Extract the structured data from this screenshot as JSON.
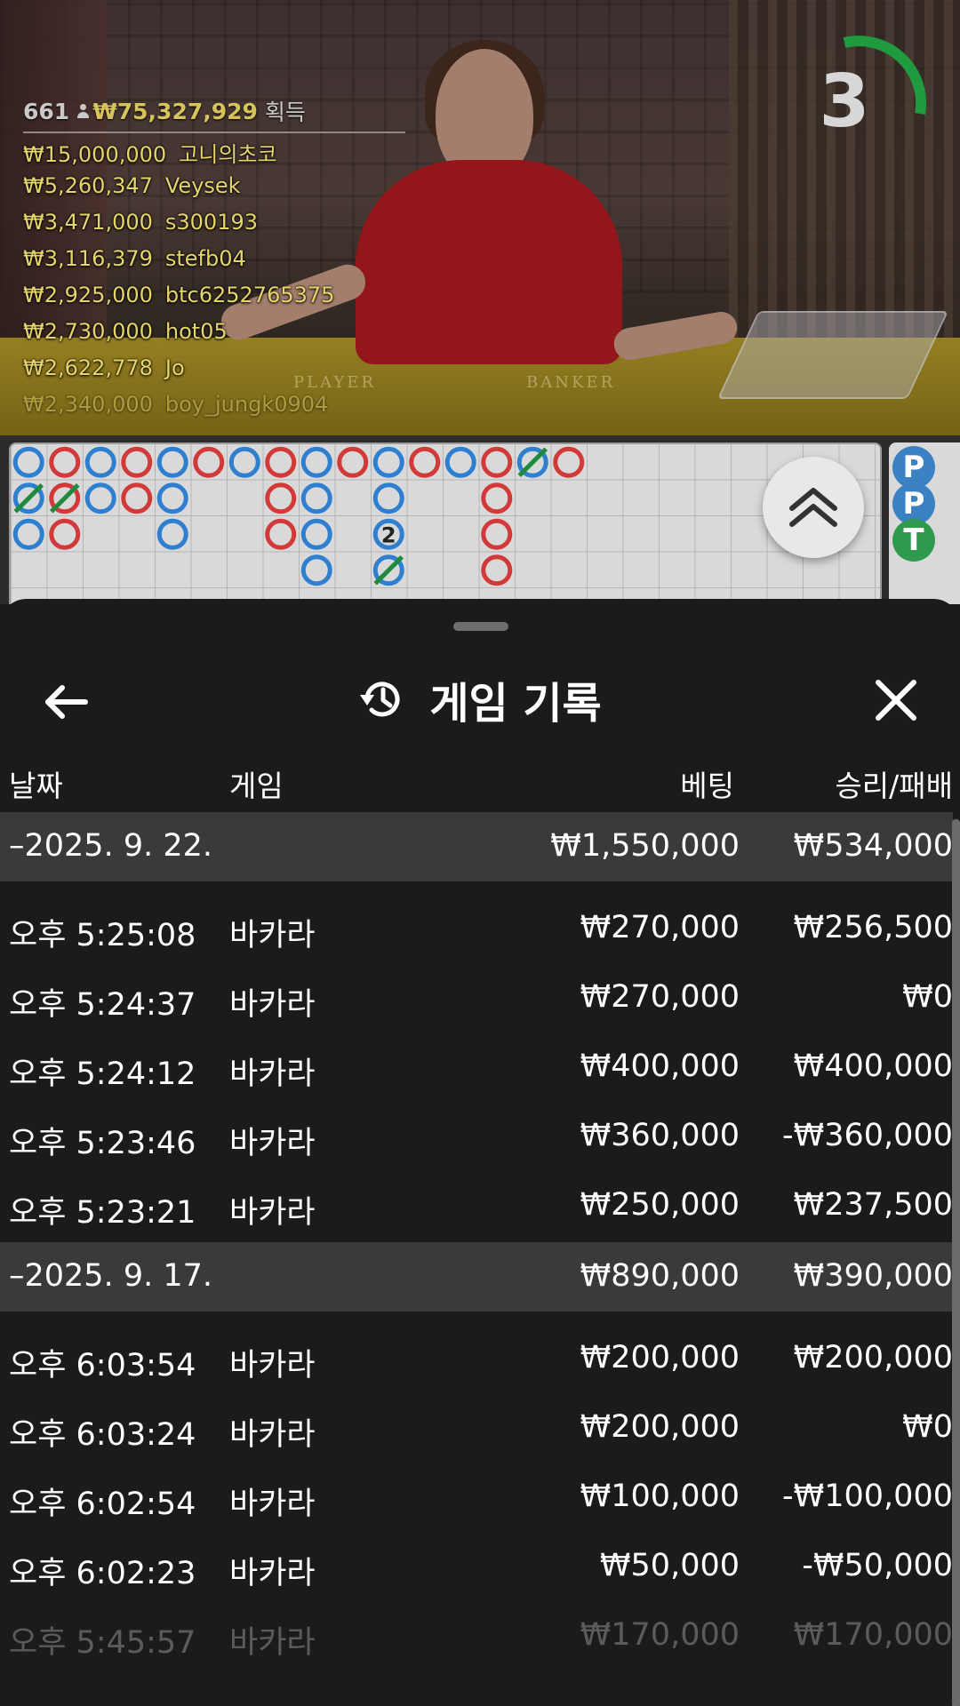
{
  "stream": {
    "player_label": "PLAYER",
    "banker_label": "BANKER",
    "timer": "3",
    "winners": {
      "count": "661",
      "total": "₩75,327,929",
      "suffix": "획득",
      "list": [
        {
          "amount": "₩15,000,000",
          "name": "고니의초코"
        },
        {
          "amount": "₩5,260,347",
          "name": "Veysek"
        },
        {
          "amount": "₩3,471,000",
          "name": "s300193"
        },
        {
          "amount": "₩3,116,379",
          "name": "stefb04"
        },
        {
          "amount": "₩2,925,000",
          "name": "btc6252765375"
        },
        {
          "amount": "₩2,730,000",
          "name": "hot05"
        },
        {
          "amount": "₩2,622,778",
          "name": "Jo"
        },
        {
          "amount": "₩2,340,000",
          "name": "boy_jungk0904"
        }
      ]
    }
  },
  "roadmap": {
    "side_chips": [
      {
        "letter": "P",
        "color": "#3b82c4"
      },
      {
        "letter": "P",
        "color": "#3b82c4"
      },
      {
        "letter": "T",
        "color": "#2e9a4e"
      }
    ],
    "marker_text": "2"
  },
  "sheet": {
    "title": "게임 기록",
    "columns": {
      "date": "날짜",
      "game": "게임",
      "bet": "베팅",
      "result": "승리/패배"
    },
    "groups": [
      {
        "date": "–2025. 9. 22.",
        "bet": "₩1,550,000",
        "result": "₩534,000",
        "rows": [
          {
            "time": "오후 5:25:08",
            "game": "바카라",
            "bet": "₩270,000",
            "result": "₩256,500"
          },
          {
            "time": "오후 5:24:37",
            "game": "바카라",
            "bet": "₩270,000",
            "result": "₩0"
          },
          {
            "time": "오후 5:24:12",
            "game": "바카라",
            "bet": "₩400,000",
            "result": "₩400,000"
          },
          {
            "time": "오후 5:23:46",
            "game": "바카라",
            "bet": "₩360,000",
            "result": "-₩360,000"
          },
          {
            "time": "오후 5:23:21",
            "game": "바카라",
            "bet": "₩250,000",
            "result": "₩237,500"
          }
        ]
      },
      {
        "date": "–2025. 9. 17.",
        "bet": "₩890,000",
        "result": "₩390,000",
        "rows": [
          {
            "time": "오후 6:03:54",
            "game": "바카라",
            "bet": "₩200,000",
            "result": "₩200,000"
          },
          {
            "time": "오후 6:03:24",
            "game": "바카라",
            "bet": "₩200,000",
            "result": "₩0"
          },
          {
            "time": "오후 6:02:54",
            "game": "바카라",
            "bet": "₩100,000",
            "result": "-₩100,000"
          },
          {
            "time": "오후 6:02:23",
            "game": "바카라",
            "bet": "₩50,000",
            "result": "-₩50,000"
          },
          {
            "time": "오후 5:45:57",
            "game": "바카라",
            "bet": "₩170,000",
            "result": "₩170,000"
          }
        ]
      }
    ]
  }
}
